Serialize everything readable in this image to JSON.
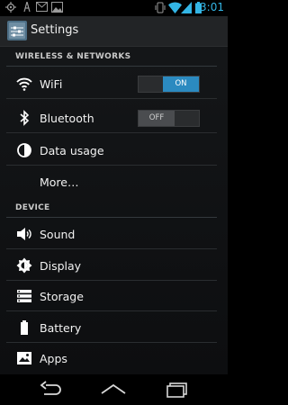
{
  "status_bar": {
    "time": "3:01",
    "icons": [
      "gps-icon",
      "usb-icon",
      "gmail-icon",
      "image-icon",
      "vibrate-icon",
      "wifi-signal-icon",
      "cell-signal-icon",
      "battery-icon"
    ]
  },
  "action_bar": {
    "title": "Settings"
  },
  "sections": {
    "wireless": "WIRELESS & NETWORKS",
    "device": "DEVICE"
  },
  "items": {
    "wifi": {
      "label": "WiFi",
      "toggle": "ON",
      "enabled": true
    },
    "bluetooth": {
      "label": "Bluetooth",
      "toggle": "OFF",
      "enabled": false
    },
    "data_usage": {
      "label": "Data usage"
    },
    "more": {
      "label": "More…"
    },
    "sound": {
      "label": "Sound"
    },
    "display": {
      "label": "Display"
    },
    "storage": {
      "label": "Storage"
    },
    "battery": {
      "label": "Battery"
    },
    "apps": {
      "label": "Apps"
    }
  },
  "colors": {
    "accent": "#33b5e5",
    "toggle_on": "#2b8ac0"
  }
}
